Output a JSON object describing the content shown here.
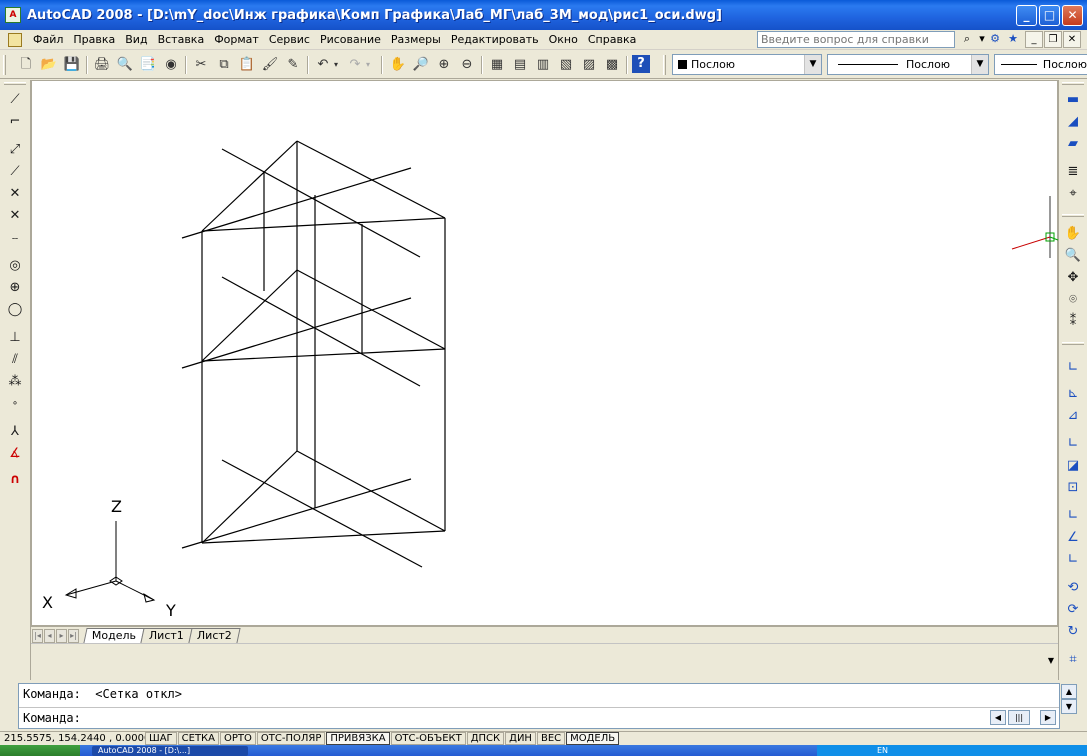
{
  "window": {
    "title": "AutoCAD 2008 - [D:\\mY_doc\\Инж графика\\Комп Графика\\Лаб_МГ\\лаб_3М_мод\\рис1_оси.dwg]",
    "app_icon_text": "A",
    "minimize": "_",
    "maximize": "□",
    "close": "✕"
  },
  "menu": {
    "items": [
      "Файл",
      "Правка",
      "Вид",
      "Вставка",
      "Формат",
      "Сервис",
      "Рисование",
      "Размеры",
      "Редактировать",
      "Окно",
      "Справка"
    ],
    "help_placeholder": "Введите вопрос для справки",
    "help_search_icon": "⌕",
    "help_dropdown": "▾",
    "mdi_minimize": "_",
    "mdi_restore": "❐",
    "mdi_close": "✕"
  },
  "toolbar": {
    "layer_value": "Послою",
    "linetype_value": "Послою",
    "lineweight_value": "Послою",
    "combo_arrow": "▼"
  },
  "tabs": {
    "items": [
      "Модель",
      "Лист1",
      "Лист2"
    ],
    "active": "Модель"
  },
  "command": {
    "history": "Команда:  <Сетка откл>",
    "prompt": "Команда:"
  },
  "status": {
    "coords": "215.5575, 154.2440 , 0.0000",
    "toggles": [
      {
        "label": "ШАГ",
        "on": false
      },
      {
        "label": "СЕТКА",
        "on": false
      },
      {
        "label": "ОРТО",
        "on": false
      },
      {
        "label": "ОТС-ПОЛЯР",
        "on": false
      },
      {
        "label": "ПРИВЯЗКА",
        "on": true
      },
      {
        "label": "ОТС-ОБЪЕКТ",
        "on": false
      },
      {
        "label": "ДПСК",
        "on": false
      },
      {
        "label": "ДИН",
        "on": false
      },
      {
        "label": "ВЕС",
        "on": false
      },
      {
        "label": "МОДЕЛЬ",
        "on": true
      }
    ]
  },
  "ucs": {
    "x_label": "X",
    "y_label": "Y",
    "z_label": "Z"
  },
  "taskbar": {
    "task_label": "AutoCAD 2008 - [D:\\...]",
    "tray_text": "EN"
  },
  "colors": {
    "ucs_x_axis": "#c80000",
    "ucs_y_axis": "#00a000",
    "ucs_z_axis": "#3a3a3a",
    "title_gradient": "#1f63df"
  },
  "icons": {
    "left": [
      "line-icon",
      "construction-line-icon",
      "polyline-icon",
      "polygon-icon",
      "rectangle-icon",
      "arc-icon",
      "circle-icon",
      "revision-cloud-icon",
      "spline-icon",
      "ellipse-icon",
      "ellipse-arc-icon",
      "insert-block-icon",
      "make-block-icon",
      "point-icon",
      "hatch-icon",
      "gradient-icon",
      "region-icon"
    ],
    "right": [
      "dimension-linear-icon",
      "dimension-aligned-icon",
      "dimension-arc-icon",
      "dimension-ordinate-icon",
      "dimension-radius-icon",
      "pan-icon",
      "zoom-realtime-icon",
      "orbit-icon",
      "camera-icon",
      "walk-icon",
      "ucs-icon",
      "ucs-world-icon",
      "ucs-previous-icon",
      "ucs-face-icon",
      "ucs-object-icon",
      "ucs-view-icon",
      "ucs-origin-icon",
      "ucs-zaxis-icon",
      "ucs-3point-icon",
      "ucs-x-icon",
      "ucs-y-icon",
      "ucs-z-icon"
    ]
  }
}
